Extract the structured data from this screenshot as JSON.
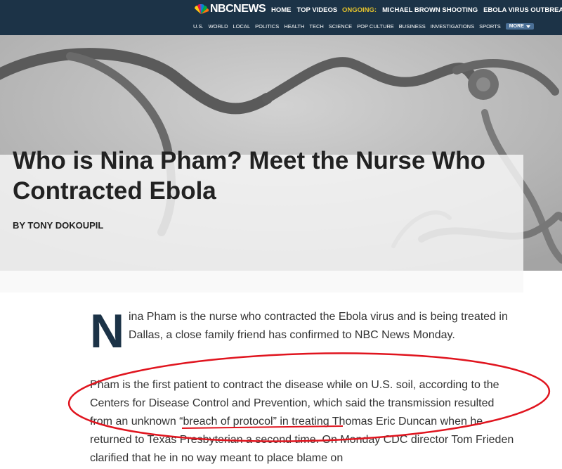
{
  "header": {
    "logo_text": "NBCNEWS",
    "nav": [
      {
        "label": "HOME"
      },
      {
        "label": "TOP VIDEOS"
      }
    ],
    "ongoing_label": "ONGOING:",
    "ongoing": [
      {
        "label": "MICHAEL BROWN SHOOTING"
      },
      {
        "label": "EBOLA VIRUS OUTBREAK"
      }
    ],
    "sections": [
      "U.S.",
      "WORLD",
      "LOCAL",
      "POLITICS",
      "HEALTH",
      "TECH",
      "SCIENCE",
      "POP CULTURE",
      "BUSINESS",
      "INVESTIGATIONS",
      "SPORTS"
    ],
    "more_label": "MORE"
  },
  "article": {
    "title": "Who is Nina Pham? Meet the Nurse Who Contracted Ebola",
    "byline": "BY TONY DOKOUPIL",
    "dropcap": "N",
    "p1": "ina Pham is the nurse who contracted the Ebola virus and is being treated in Dallas, a close family friend has confirmed to NBC News Monday.",
    "p2": "Pham is the first patient to contract the disease while on U.S. soil, according to the Centers for Disease Control and Prevention, which said the transmission resulted from an unknown “breach of protocol” in treating Thomas Eric Duncan when he returned to Texas Presbyterian a second time. On Monday CDC director Tom Frieden clarified that he in no way meant to place blame on"
  },
  "colors": {
    "header_bg": "#1c3347",
    "ongoing": "#e3c22d",
    "annotation": "#e0141e"
  }
}
